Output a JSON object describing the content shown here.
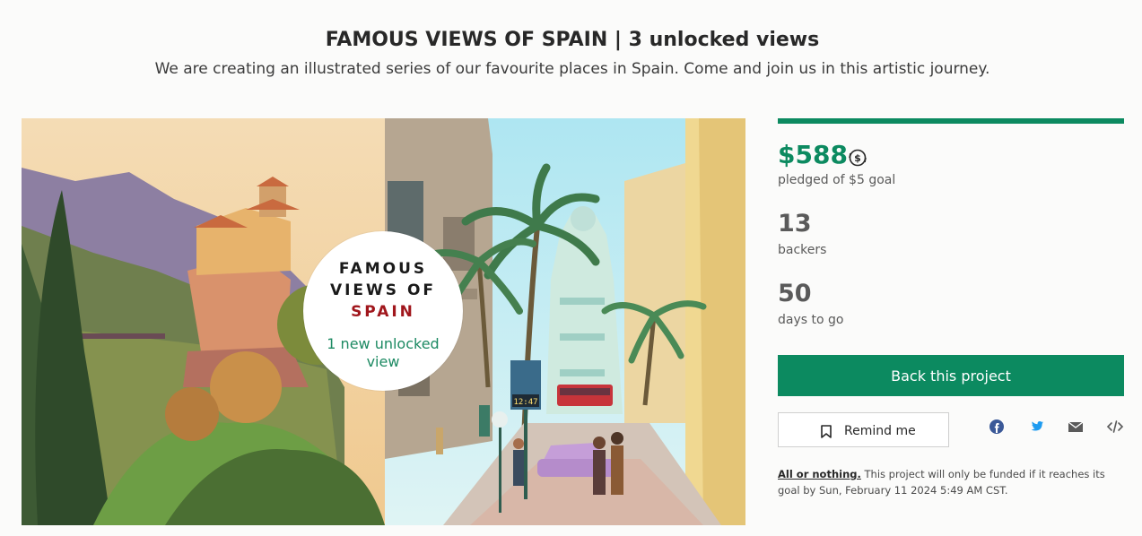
{
  "header": {
    "title": "FAMOUS VIEWS OF SPAIN | 3 unlocked views",
    "subtitle": "We are creating an illustrated series of our favourite places in Spain. Come and join us in this artistic journey."
  },
  "hero": {
    "badge_line1": "FAMOUS",
    "badge_line2": "VIEWS OF",
    "badge_line3": "SPAIN",
    "badge_sub": "1 new unlocked view",
    "clock_text": "12:47"
  },
  "campaign": {
    "progress_fraction": 1.0,
    "pledged": "$588",
    "pledged_label": "pledged of $5 goal",
    "backers": "13",
    "backers_label": "backers",
    "days": "50",
    "days_label": "days to go",
    "back_button": "Back this project",
    "remind_button": "Remind me",
    "all_or_nothing": "All or nothing.",
    "funding_note": "This project will only be funded if it reaches its goal by Sun, February 11 2024 5:49 AM CST."
  },
  "share_icons": [
    "facebook-icon",
    "twitter-icon",
    "email-icon",
    "embed-icon"
  ],
  "colors": {
    "brand_green": "#0c8a60",
    "badge_red": "#a0161c",
    "twitter_blue": "#1d9bf0",
    "facebook_blue": "#3b5998"
  }
}
